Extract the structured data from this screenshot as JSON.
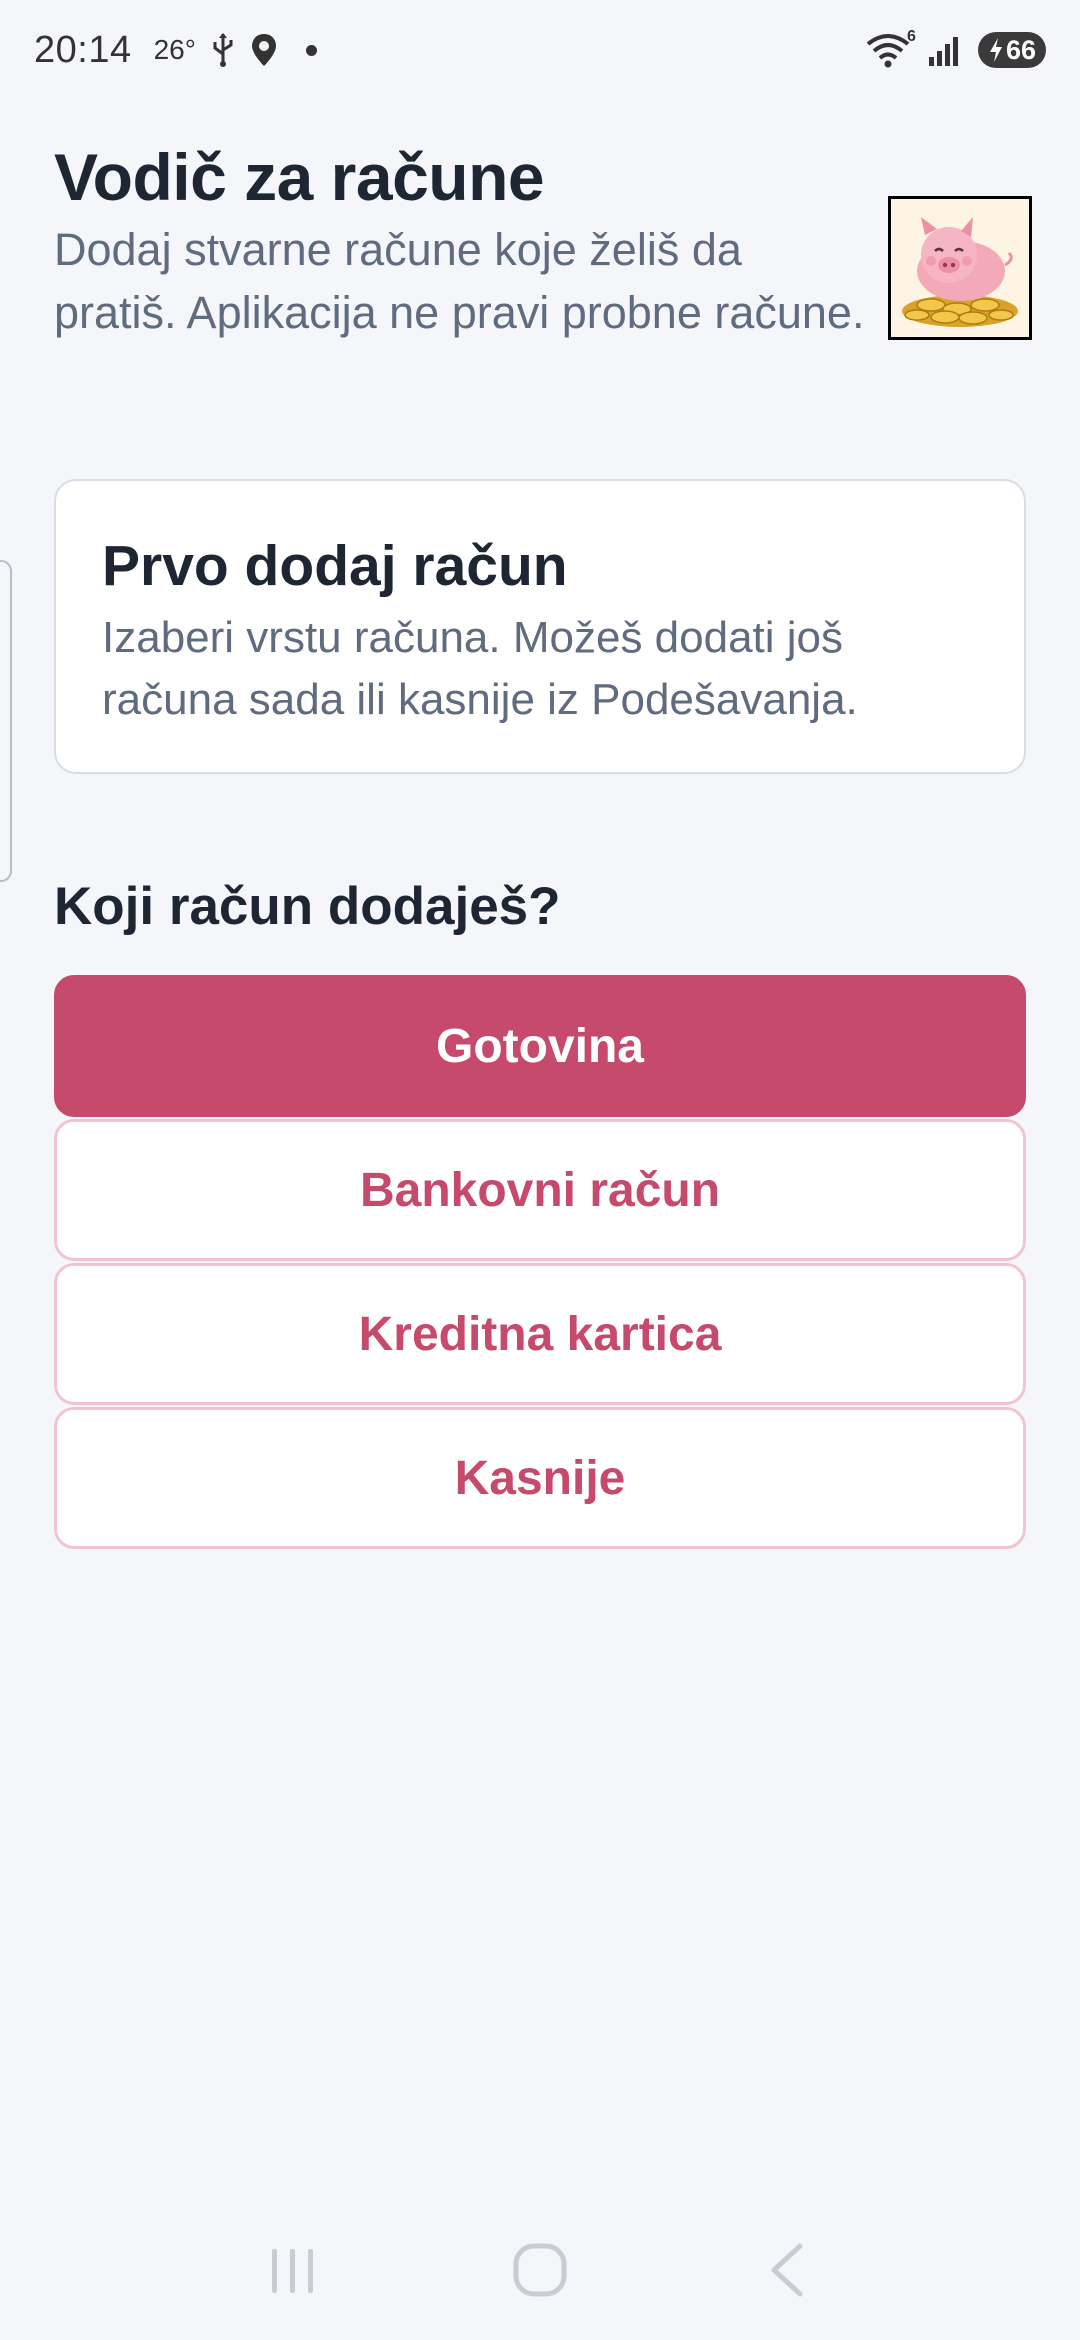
{
  "status_bar": {
    "time": "20:14",
    "temperature": "26°",
    "wifi_label": "6",
    "battery_level": "66"
  },
  "header": {
    "title": "Vodič za račune",
    "subtitle": "Dodaj stvarne račune koje želiš da pratiš. Aplikacija ne pravi probne račune."
  },
  "info_card": {
    "title": "Prvo dodaj račun",
    "text": "Izaberi vrstu računa. Možeš dodati još računa sada ili kasnije iz Podešavanja."
  },
  "question": "Koji račun dodaješ?",
  "options": [
    {
      "label": "Gotovina",
      "selected": true
    },
    {
      "label": "Bankovni račun",
      "selected": false
    },
    {
      "label": "Kreditna kartica",
      "selected": false
    },
    {
      "label": "Kasnije",
      "selected": false
    }
  ],
  "colors": {
    "accent": "#c54a6b",
    "accent_border": "#f2c4cf",
    "background": "#f5f6fa",
    "title_text": "#1e2633",
    "muted_text": "#5f6b7e"
  },
  "icons": {
    "status": [
      "usb-icon",
      "location-icon",
      "wifi-icon",
      "signal-icon",
      "battery-charging-icon"
    ],
    "logo": "piggy-bank-coins-logo",
    "nav": [
      "recent-apps-icon",
      "home-icon",
      "back-icon"
    ]
  }
}
